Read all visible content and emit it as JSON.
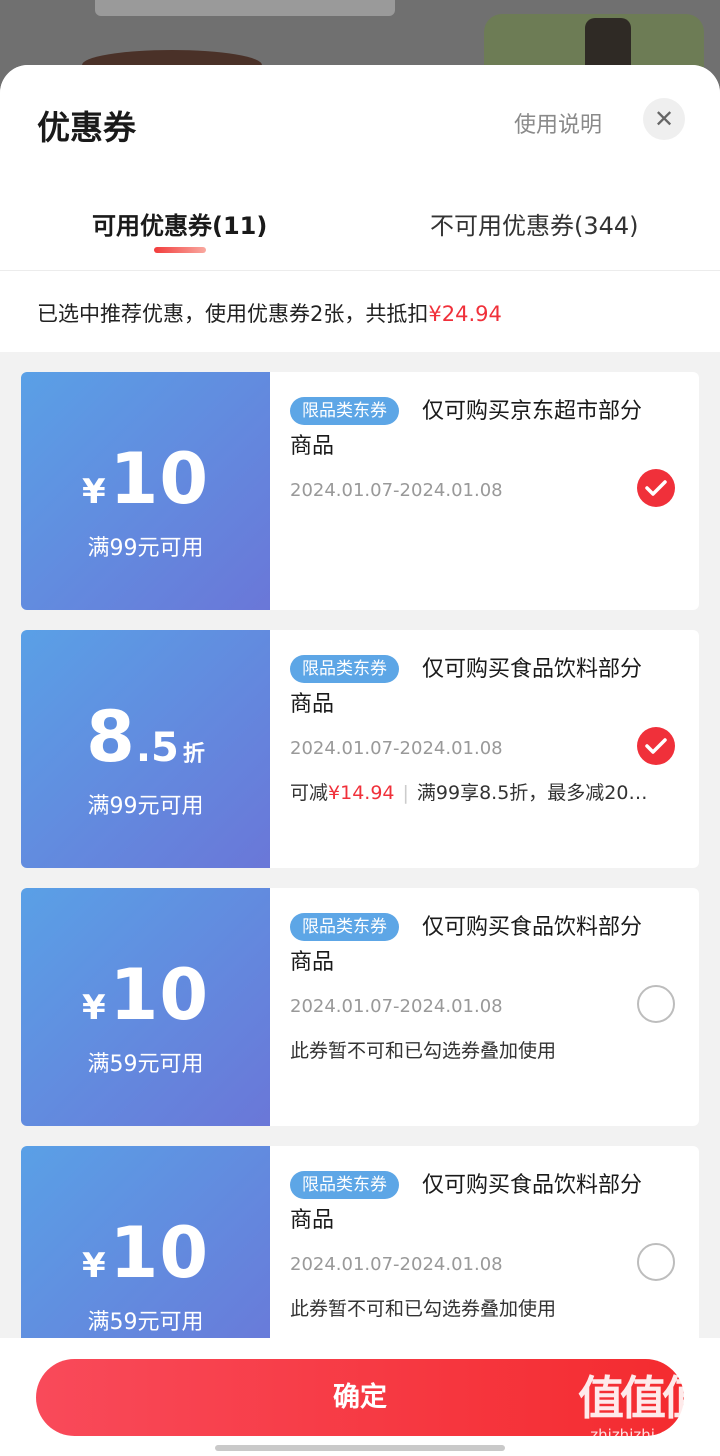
{
  "header": {
    "title": "优惠券",
    "help_label": "使用说明",
    "close_symbol": "✕"
  },
  "tabs": [
    {
      "label": "可用优惠券(11)",
      "active": true
    },
    {
      "label": "不可用优惠券(344)",
      "active": false
    }
  ],
  "summary": {
    "text": "已选中推荐优惠，使用优惠券2张，共抵扣",
    "amount": "¥24.94"
  },
  "coupons": [
    {
      "currency": "¥",
      "value": "10",
      "unit": "",
      "condition": "满99元可用",
      "tag": "限品类东券",
      "description": "仅可购买京东超市部分商品",
      "dates": "2024.01.07-2024.01.08",
      "note": "",
      "selected": true
    },
    {
      "currency": "",
      "value_int": "8",
      "value_frac": ".5",
      "unit": "折",
      "condition": "满99元可用",
      "tag": "限品类东券",
      "description": "仅可购买食品饮料部分商品",
      "dates": "2024.01.07-2024.01.08",
      "note_prefix": "可减",
      "note_amount": "¥14.94",
      "note_rest": "满99享8.5折，最多减20…",
      "selected": true
    },
    {
      "currency": "¥",
      "value": "10",
      "unit": "",
      "condition": "满59元可用",
      "tag": "限品类东券",
      "description": "仅可购买食品饮料部分商品",
      "dates": "2024.01.07-2024.01.08",
      "note": "此券暂不可和已勾选券叠加使用",
      "selected": false
    },
    {
      "currency": "¥",
      "value": "10",
      "unit": "",
      "condition": "满59元可用",
      "tag": "限品类东券",
      "description": "仅可购买食品饮料部分商品",
      "dates": "2024.01.07-2024.01.08",
      "note": "此券暂不可和已勾选券叠加使用",
      "selected": false
    }
  ],
  "footer": {
    "confirm_label": "确定"
  },
  "watermark": {
    "logo_text": "值值值",
    "site": "zhizhizhi.com"
  },
  "colors": {
    "accent_red": "#f0303a",
    "coupon_blue_start": "#5aa0e6",
    "coupon_blue_end": "#6a77d8",
    "tag_blue": "#5da6e6"
  },
  "icons": [
    "close-icon",
    "check-icon",
    "radio-empty-icon"
  ]
}
